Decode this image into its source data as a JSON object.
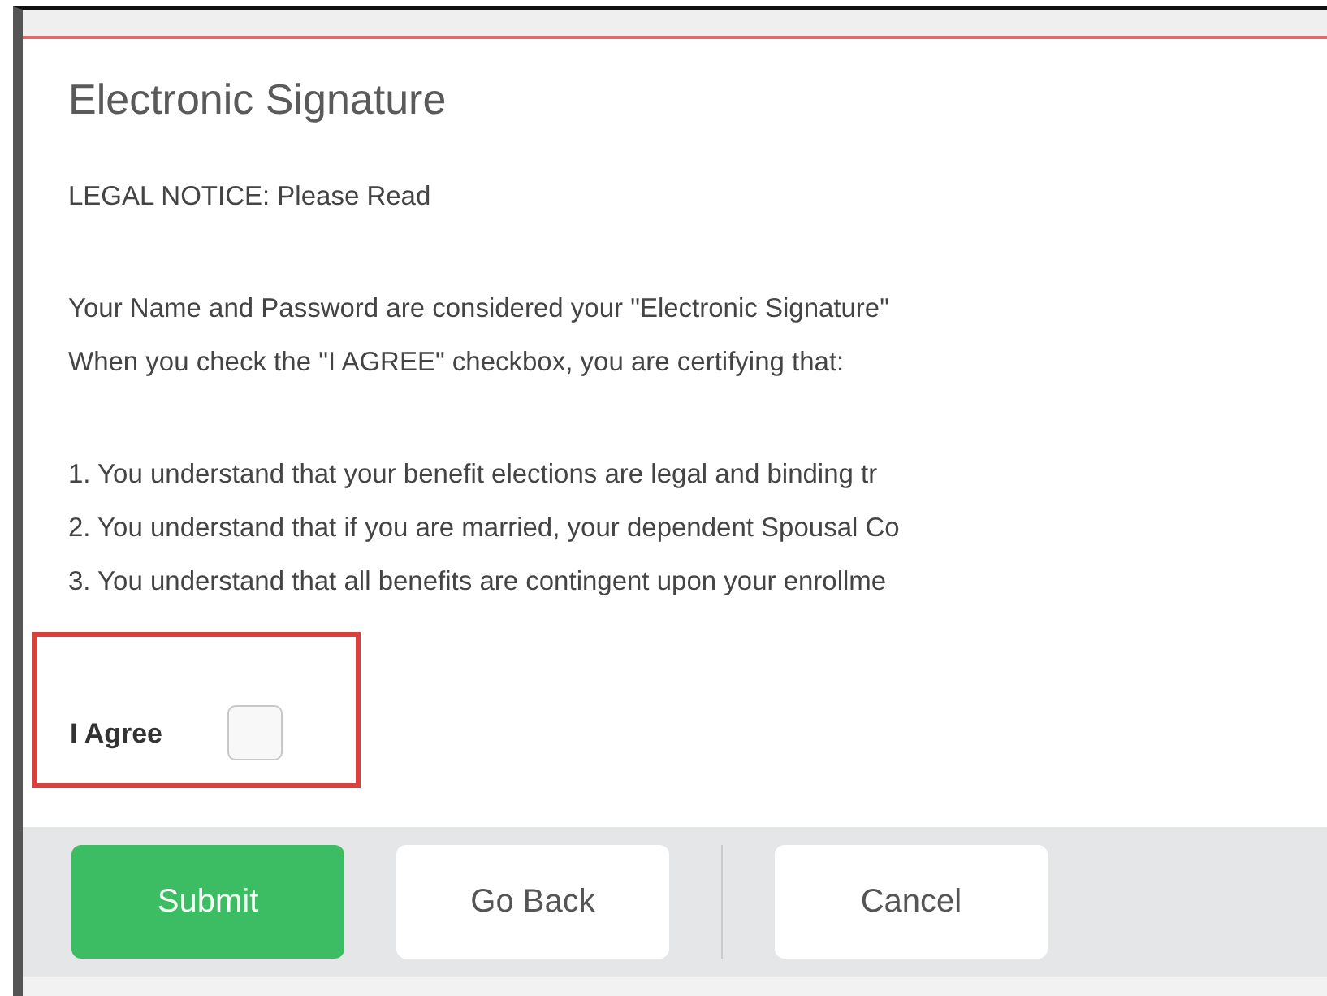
{
  "title": "Electronic Signature",
  "notice": "LEGAL NOTICE: Please Read",
  "intro": [
    "Your Name and Password are considered your \"Electronic Signature\"",
    "When you check the \"I AGREE\" checkbox, you are certifying that:"
  ],
  "terms": [
    "1. You understand that your benefit elections are legal and binding tr",
    "2. You understand that if you are married, your dependent Spousal Co",
    "3. You understand that all benefits are contingent upon your enrollme"
  ],
  "agree": {
    "label": "I Agree",
    "checked": false
  },
  "buttons": [
    {
      "label": "Submit",
      "kind": "primary"
    },
    {
      "label": "Go Back",
      "kind": "secondary"
    },
    {
      "label": "Cancel",
      "kind": "secondary",
      "separated": true
    }
  ]
}
